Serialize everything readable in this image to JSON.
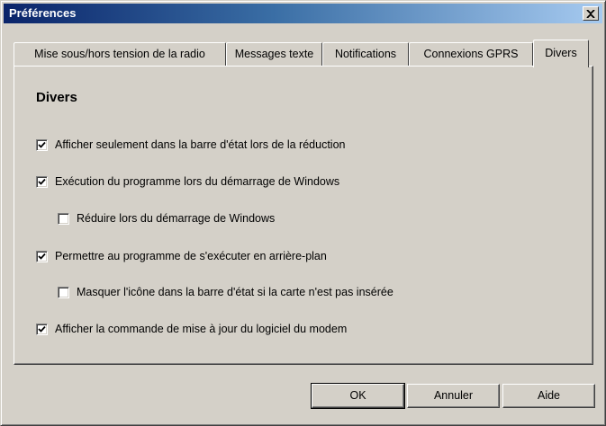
{
  "window": {
    "title": "Préférences",
    "close_icon": "close-icon"
  },
  "tabs": [
    {
      "label": "Mise sous/hors tension de la radio",
      "active": false
    },
    {
      "label": "Messages texte",
      "active": false
    },
    {
      "label": "Notifications",
      "active": false
    },
    {
      "label": "Connexions GPRS",
      "active": false
    },
    {
      "label": "Divers",
      "active": true
    }
  ],
  "panel": {
    "title": "Divers",
    "options": [
      {
        "label": "Afficher seulement dans la barre d'état lors de la réduction",
        "checked": true
      },
      {
        "label": "Exécution du programme lors du démarrage de Windows",
        "checked": true
      },
      {
        "label": "Réduire lors du démarrage de Windows",
        "checked": false
      },
      {
        "label": "Permettre au programme de s'exécuter en arrière-plan",
        "checked": true
      },
      {
        "label": "Masquer l'icône dans la barre d'état si la carte n'est pas insérée",
        "checked": false
      },
      {
        "label": "Afficher la commande de mise à jour du logiciel du modem",
        "checked": true
      }
    ]
  },
  "buttons": {
    "ok": "OK",
    "cancel": "Annuler",
    "help": "Aide"
  }
}
